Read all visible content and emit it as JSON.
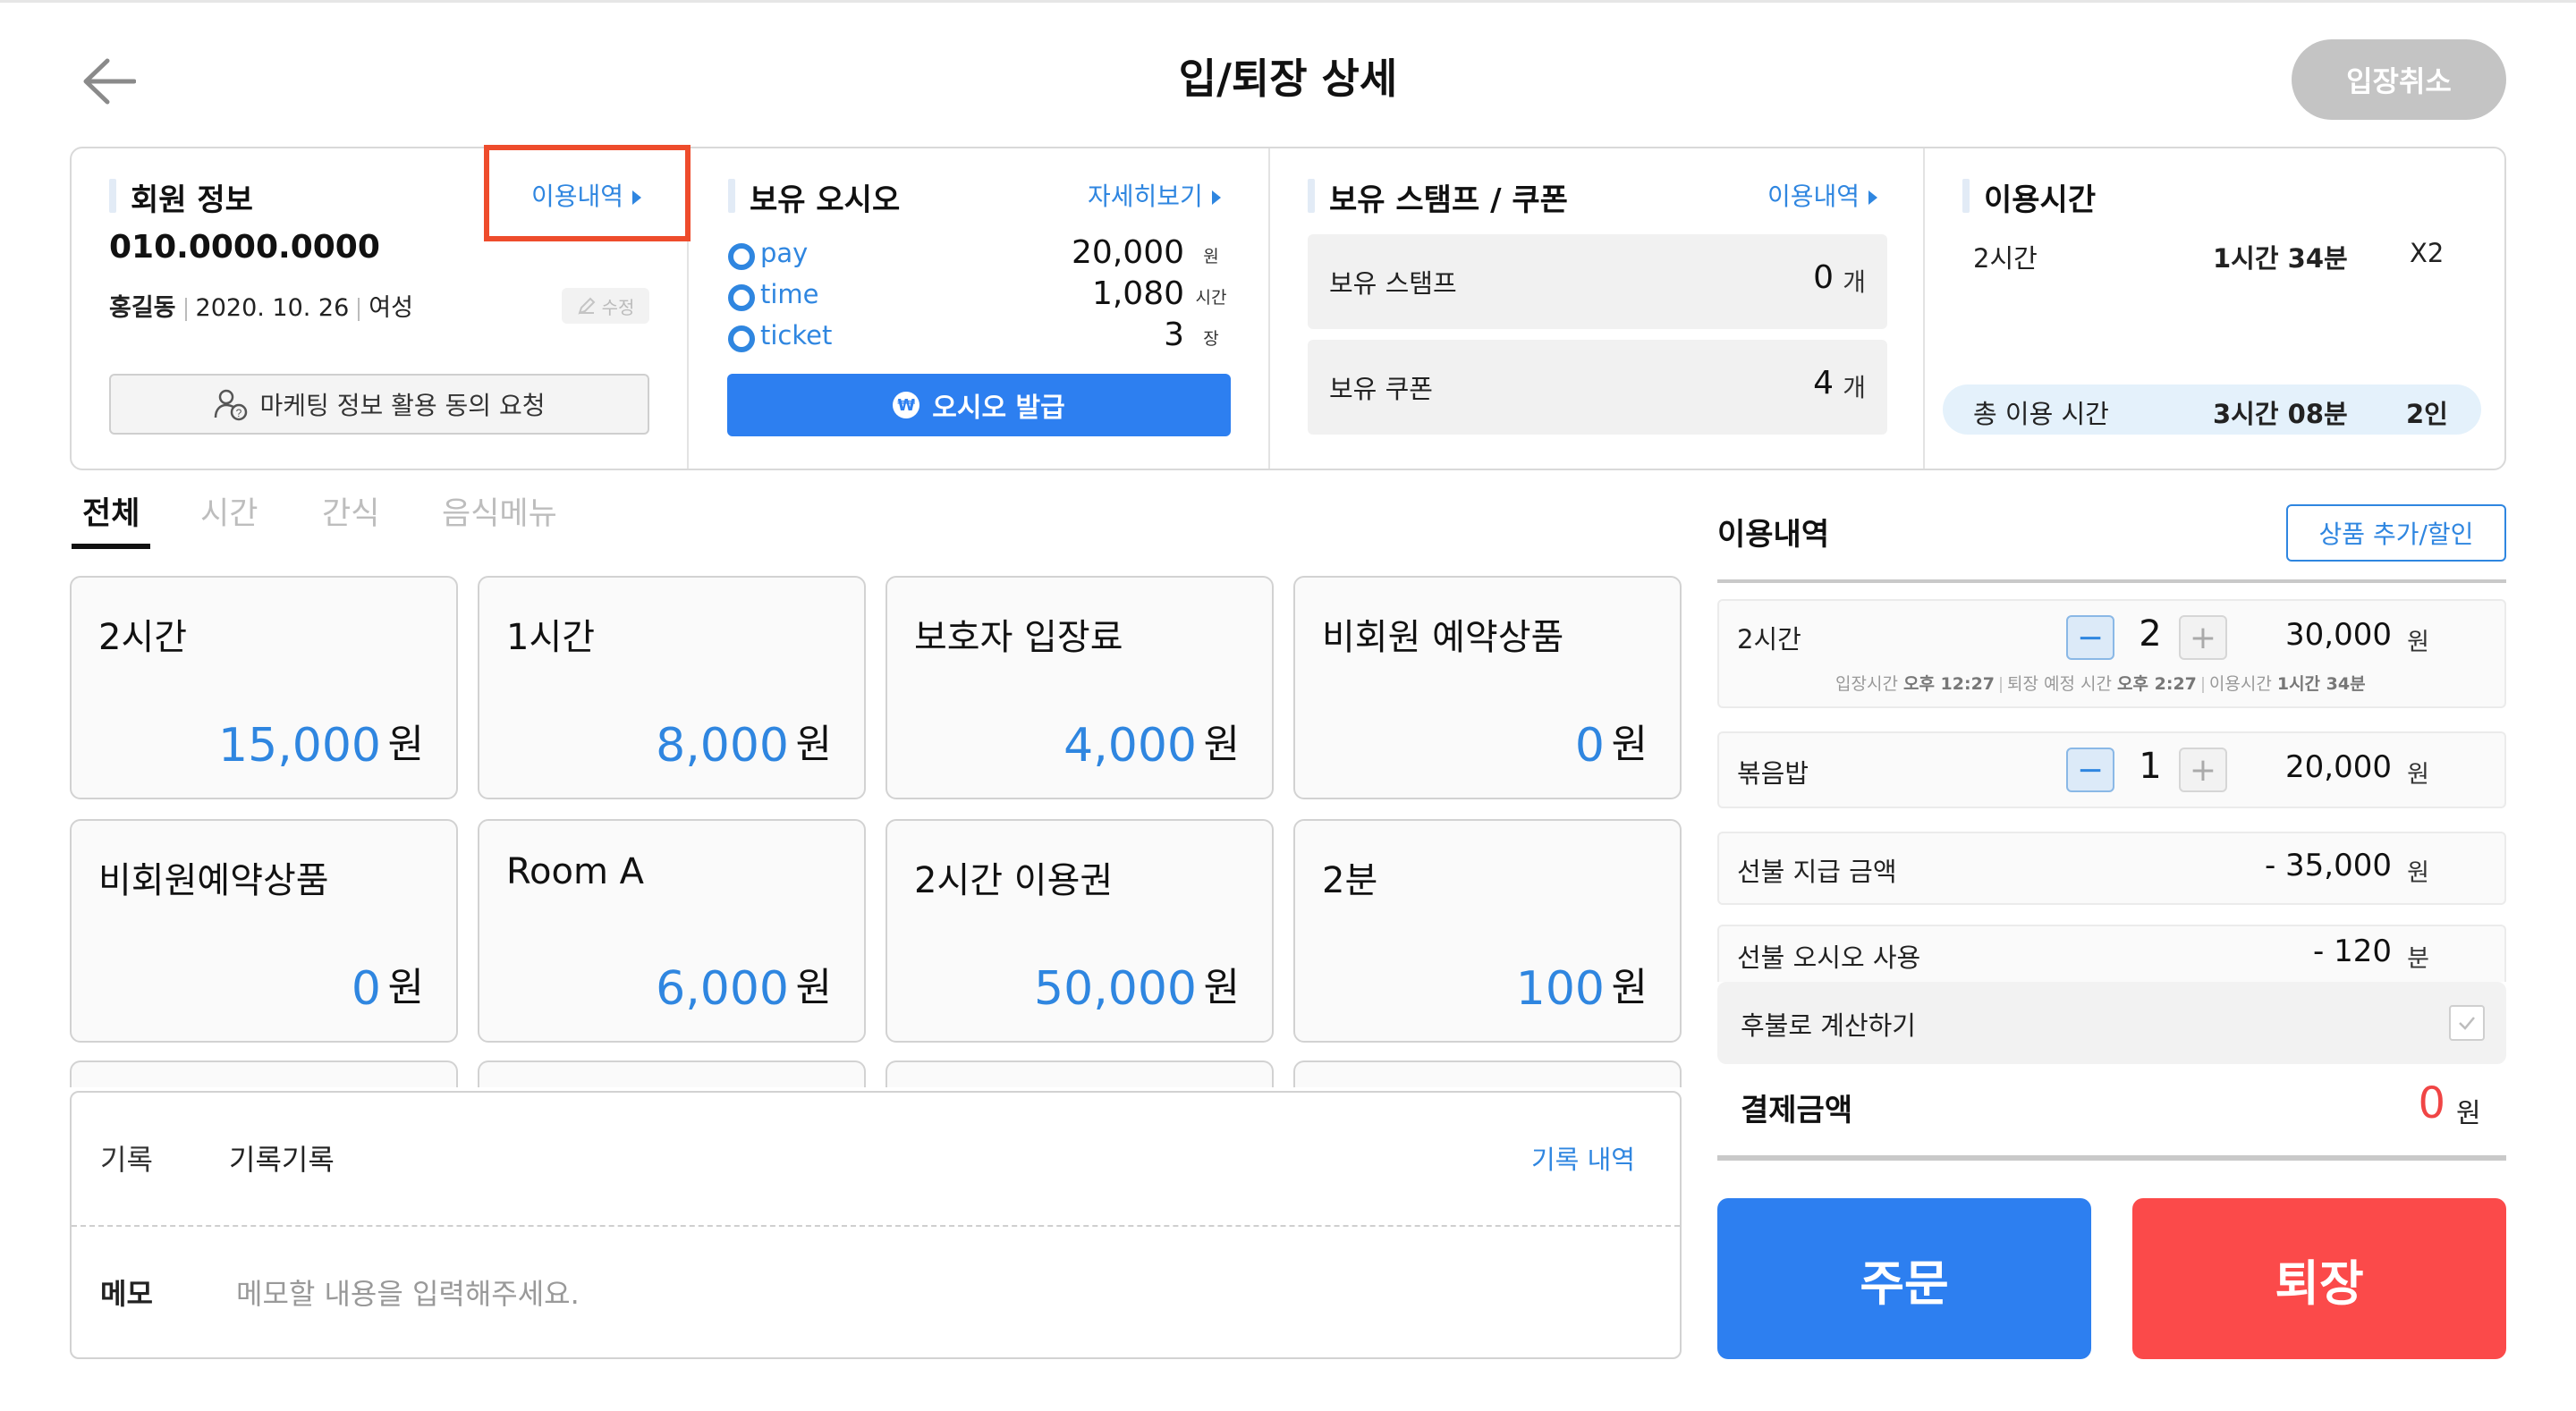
{
  "header": {
    "title": "입/퇴장 상세",
    "cancel_label": "입장취소"
  },
  "member": {
    "title": "회원 정보",
    "history_link": "이용내역",
    "phone": "010.0000.0000",
    "name": "홍길동",
    "birth": "2020. 10. 26",
    "gender": "여성",
    "edit_label": "수정",
    "marketing_label": "마케팅 정보 활용 동의 요청"
  },
  "wallet": {
    "title": "보유 오시오",
    "detail_link": "자세히보기",
    "rows": [
      {
        "label": "pay",
        "value": "20,000",
        "unit": "원"
      },
      {
        "label": "time",
        "value": "1,080",
        "unit": "시간"
      },
      {
        "label": "ticket",
        "value": "3",
        "unit": "장"
      }
    ],
    "issue_label": "오시오 발급",
    "coin_glyph": "₩"
  },
  "stamps": {
    "title": "보유 스탬프 / 쿠폰",
    "history_link": "이용내역",
    "stamp_label": "보유 스탬프",
    "stamp_value": "0",
    "stamp_unit": "개",
    "coupon_label": "보유 쿠폰",
    "coupon_value": "4",
    "coupon_unit": "개"
  },
  "usage": {
    "title": "이용시간",
    "row": {
      "product": "2시간",
      "time": "1시간 34분",
      "mult": "X2"
    },
    "total_label": "총 이용 시간",
    "total_time": "3시간 08분",
    "total_people": "2인"
  },
  "tabs": [
    "전체",
    "시간",
    "간식",
    "음식메뉴"
  ],
  "products": [
    {
      "name": "2시간",
      "price": "15,000"
    },
    {
      "name": "1시간",
      "price": "8,000"
    },
    {
      "name": "보호자 입장료",
      "price": "4,000"
    },
    {
      "name": "비회원 예약상품",
      "price": "0"
    },
    {
      "name": "비회원예약상품",
      "price": "0"
    },
    {
      "name": "Room A",
      "price": "6,000"
    },
    {
      "name": "2시간 이용권",
      "price": "50,000"
    },
    {
      "name": "2분",
      "price": "100"
    }
  ],
  "currency_unit": "원",
  "record": {
    "label": "기록",
    "value": "기록기록",
    "history_link": "기록 내역"
  },
  "memo": {
    "label": "메모",
    "placeholder": "메모할 내용을 입력해주세요."
  },
  "order": {
    "title": "이용내역",
    "add_label": "상품 추가/할인",
    "items": [
      {
        "name": "2시간",
        "qty": "2",
        "amount": "30,000",
        "unit": "원",
        "entry_label": "입장시간",
        "entry_time": "오후 12:27",
        "exit_label": "퇴장 예정 시간",
        "exit_time": "오후 2:27",
        "use_label": "이용시간",
        "use_time": "1시간 34분"
      },
      {
        "name": "볶음밥",
        "qty": "1",
        "amount": "20,000",
        "unit": "원"
      }
    ],
    "prepaid_label": "선불 지급 금액",
    "prepaid_value": "- 35,000",
    "prepaid_unit": "원",
    "prepaid_osio_label": "선불 오시오 사용",
    "prepaid_osio_value": "- 120",
    "prepaid_osio_unit": "분",
    "paylater_label": "후불로 계산하기",
    "total_label": "결제금액",
    "total_value": "0",
    "total_unit": "원"
  },
  "actions": {
    "order_label": "주문",
    "checkout_label": "퇴장"
  },
  "colors": {
    "accent_blue": "#2f86e0",
    "order_button": "#2d7ff0",
    "checkout_button": "#fb4a4a",
    "highlight": "#ee4c2c",
    "total_value": "#f04545"
  }
}
